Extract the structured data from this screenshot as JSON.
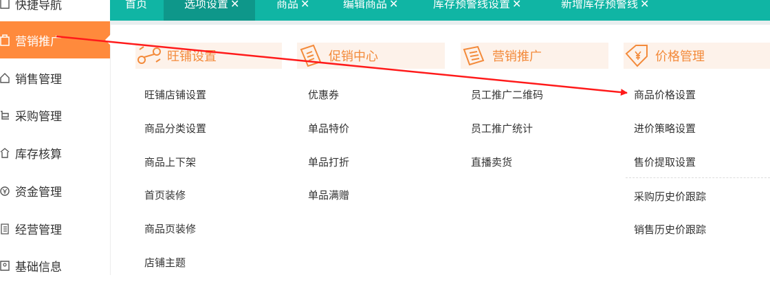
{
  "sidebar": {
    "items": [
      {
        "label": "快捷导航",
        "icon": "star-icon"
      },
      {
        "label": "营销推广",
        "icon": "bag-icon",
        "active": true
      },
      {
        "label": "销售管理",
        "icon": "home-icon"
      },
      {
        "label": "采购管理",
        "icon": "cart-icon"
      },
      {
        "label": "库存核算",
        "icon": "warehouse-icon"
      },
      {
        "label": "资金管理",
        "icon": "money-icon"
      },
      {
        "label": "经营管理",
        "icon": "list-icon"
      },
      {
        "label": "基础信息",
        "icon": "id-card-icon"
      }
    ]
  },
  "tabs": [
    {
      "label": "首页",
      "closable": false
    },
    {
      "label": "选项设置",
      "closable": true,
      "active": true
    },
    {
      "label": "商品",
      "closable": true
    },
    {
      "label": "编辑商品",
      "closable": true
    },
    {
      "label": "库存预警线设置",
      "closable": true
    },
    {
      "label": "新增库存预警线",
      "closable": true
    }
  ],
  "close_glyph": "✕",
  "groups": [
    {
      "title": "旺铺设置",
      "icon": "shop-settings-icon",
      "items": [
        "旺铺店铺设置",
        "商品分类设置",
        "商品上下架",
        "首页装修",
        "商品页装修",
        "店铺主题"
      ]
    },
    {
      "title": "促销中心",
      "icon": "coupon-icon",
      "items": [
        "优惠券",
        "单品特价",
        "单品打折",
        "单品满赠"
      ]
    },
    {
      "title": "营销推广",
      "icon": "promotion-icon",
      "items": [
        "员工推广二维码",
        "员工推广统计",
        "直播卖货"
      ]
    },
    {
      "title": "价格管理",
      "icon": "price-tag-icon",
      "items": [
        "商品价格设置",
        "进价策略设置",
        "售价提取设置",
        "采购历史价跟踪",
        "销售历史价跟踪"
      ]
    }
  ],
  "colors": {
    "tabbar": "#10b5a4",
    "tab_active": "#0e978a",
    "sidebar_active": "#ff8a3c",
    "group_title": "#f38a3a",
    "group_bg": "#fdf2ea",
    "annotation_arrow": "#ff1a1a"
  }
}
